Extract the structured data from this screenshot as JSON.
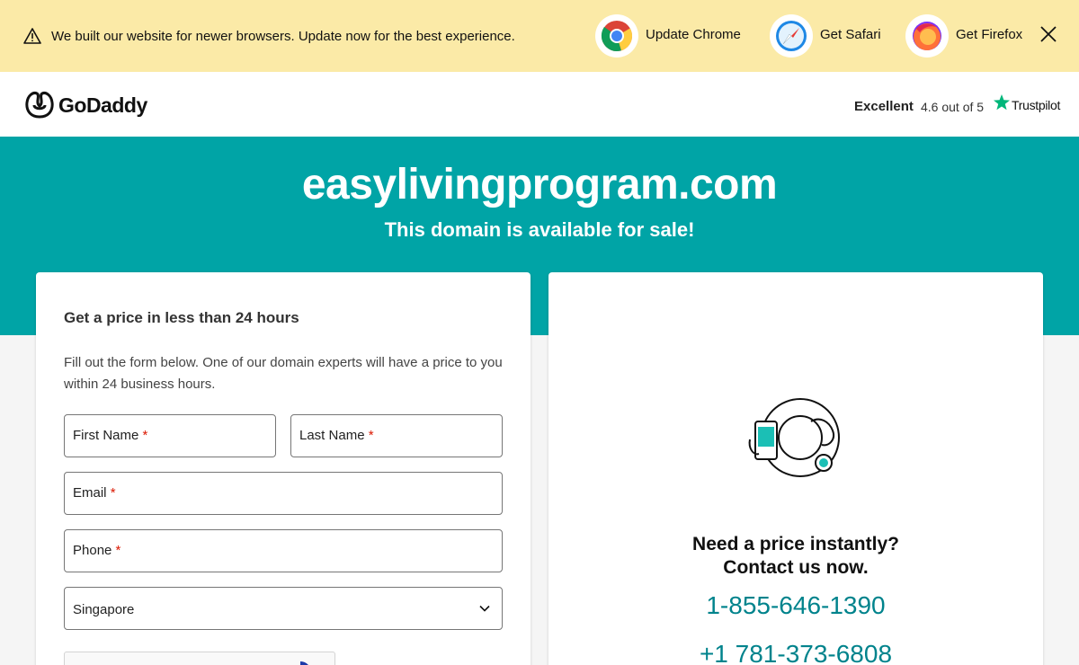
{
  "banner": {
    "message": "We built our website for newer browsers. Update now for the best experience.",
    "browsers": [
      {
        "label": "Update Chrome",
        "icon": "chrome-icon"
      },
      {
        "label": "Get Safari",
        "icon": "safari-icon"
      },
      {
        "label": "Get Firefox",
        "icon": "firefox-icon"
      }
    ],
    "warning_icon": "warning-icon",
    "close_icon": "close-icon",
    "background": "#fbeaa7"
  },
  "header": {
    "brand": "GoDaddy",
    "trustpilot": {
      "rating_word": "Excellent",
      "score": "4.6 out of 5",
      "name": "Trustpilot",
      "star_color": "#00b67a"
    }
  },
  "hero": {
    "domain": "easylivingprogram.com",
    "subtitle": "This domain is available for sale!",
    "background": "#00a4a6"
  },
  "form": {
    "title": "Get a price in less than 24 hours",
    "description": "Fill out the form below. One of our domain experts will have a price to you within 24 business hours.",
    "fields": {
      "first_name": "First Name",
      "last_name": "Last Name",
      "email": "Email",
      "phone": "Phone"
    },
    "required_mark": "*",
    "country": "Singapore"
  },
  "contact": {
    "line1": "Need a price instantly?",
    "line2": "Contact us now.",
    "phone1": "1-855-646-1390",
    "phone2": "+1 781-373-6808",
    "phone_color": "#00838c"
  }
}
